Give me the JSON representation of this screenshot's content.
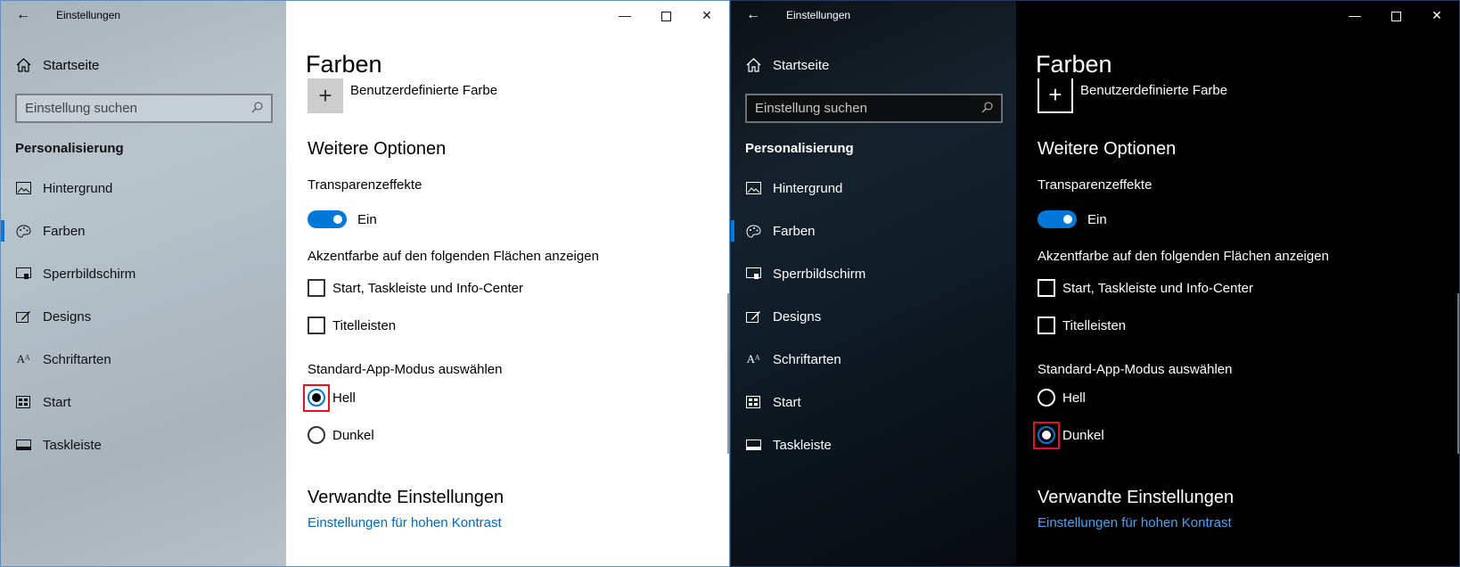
{
  "windows": [
    {
      "theme": "light",
      "title": "Einstellungen",
      "back_icon": "←",
      "controls": {
        "minimize": "—",
        "maximize": "□",
        "close": "✕"
      },
      "home": {
        "label": "Startseite",
        "icon": "home-icon"
      },
      "search": {
        "placeholder": "Einstellung suchen",
        "icon": "search-icon"
      },
      "section": "Personalisierung",
      "nav": [
        {
          "label": "Hintergrund",
          "icon": "picture-icon"
        },
        {
          "label": "Farben",
          "icon": "palette-icon",
          "active": true
        },
        {
          "label": "Sperrbildschirm",
          "icon": "lockscreen-icon"
        },
        {
          "label": "Designs",
          "icon": "brush-icon"
        },
        {
          "label": "Schriftarten",
          "icon": "font-icon"
        },
        {
          "label": "Start",
          "icon": "start-icon"
        },
        {
          "label": "Taskleiste",
          "icon": "taskbar-icon"
        }
      ],
      "page_title": "Farben",
      "custom_color": "Benutzerdefinierte Farbe",
      "more_options": "Weitere Optionen",
      "transparency": {
        "label": "Transparenzeffekte",
        "state": "Ein"
      },
      "accent_label": "Akzentfarbe auf den folgenden Flächen anzeigen",
      "checkboxes": [
        "Start, Taskleiste und Info-Center",
        "Titelleisten"
      ],
      "mode_label": "Standard-App-Modus auswählen",
      "modes": [
        "Hell",
        "Dunkel"
      ],
      "selected_mode": "Hell",
      "related_title": "Verwandte Einstellungen",
      "related_link": "Einstellungen für hohen Kontrast"
    },
    {
      "theme": "dark",
      "title": "Einstellungen",
      "back_icon": "←",
      "controls": {
        "minimize": "—",
        "maximize": "□",
        "close": "✕"
      },
      "home": {
        "label": "Startseite",
        "icon": "home-icon"
      },
      "search": {
        "placeholder": "Einstellung suchen",
        "icon": "search-icon"
      },
      "section": "Personalisierung",
      "nav": [
        {
          "label": "Hintergrund",
          "icon": "picture-icon"
        },
        {
          "label": "Farben",
          "icon": "palette-icon",
          "active": true
        },
        {
          "label": "Sperrbildschirm",
          "icon": "lockscreen-icon"
        },
        {
          "label": "Designs",
          "icon": "brush-icon"
        },
        {
          "label": "Schriftarten",
          "icon": "font-icon"
        },
        {
          "label": "Start",
          "icon": "start-icon"
        },
        {
          "label": "Taskleiste",
          "icon": "taskbar-icon"
        }
      ],
      "page_title": "Farben",
      "custom_color": "Benutzerdefinierte Farbe",
      "more_options": "Weitere Optionen",
      "transparency": {
        "label": "Transparenzeffekte",
        "state": "Ein"
      },
      "accent_label": "Akzentfarbe auf den folgenden Flächen anzeigen",
      "checkboxes": [
        "Start, Taskleiste und Info-Center",
        "Titelleisten"
      ],
      "mode_label": "Standard-App-Modus auswählen",
      "modes": [
        "Hell",
        "Dunkel"
      ],
      "selected_mode": "Dunkel",
      "related_title": "Verwandte Einstellungen",
      "related_link": "Einstellungen für hohen Kontrast"
    }
  ],
  "colors": {
    "accent": "#0078d7",
    "highlight": "#e81123",
    "link_light": "#0067c0",
    "link_dark": "#4aa3f0"
  }
}
